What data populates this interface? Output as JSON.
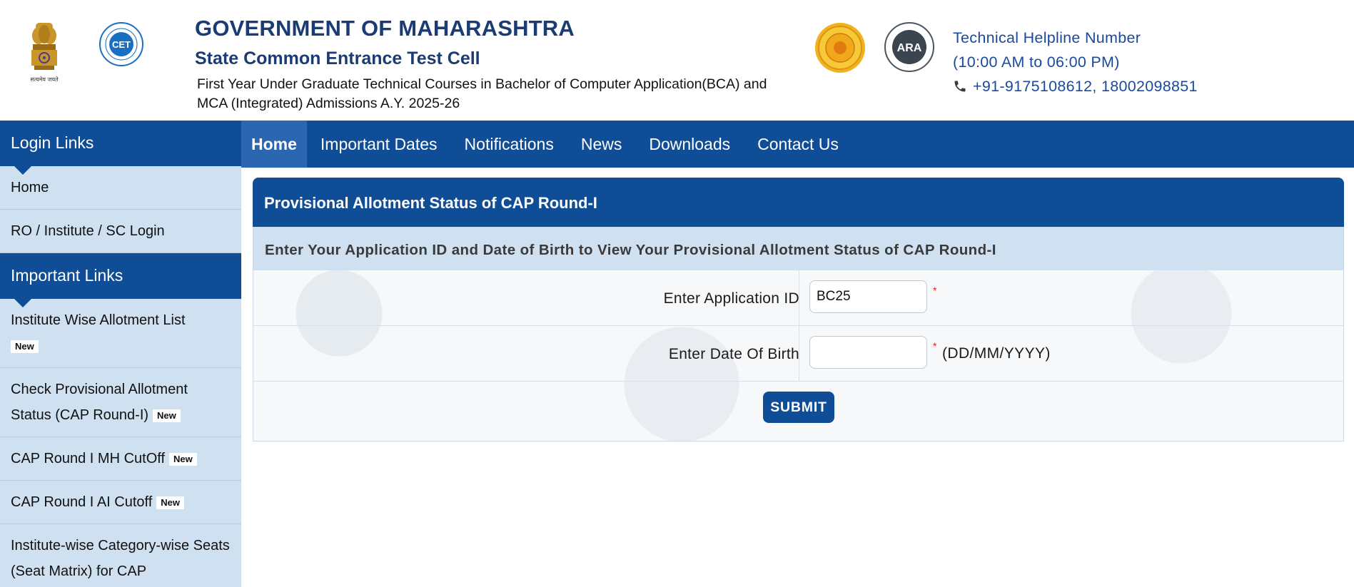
{
  "header": {
    "title": "GOVERNMENT OF MAHARASHTRA",
    "subtitle": "State Common Entrance Test Cell",
    "description": "First Year Under Graduate Technical Courses in Bachelor of Computer Application(BCA) and MCA (Integrated) Admissions A.Y. 2025-26",
    "emblem_caption": "सत्यमेव जयते",
    "cet_logo_text": "CET",
    "ara_logo_text": "ARA",
    "helpline": {
      "label": "Technical Helpline Number",
      "hours": "(10:00 AM to 06:00 PM)",
      "numbers": "+91-9175108612, 18002098851"
    }
  },
  "nav": {
    "items": [
      {
        "label": "Home",
        "active": true
      },
      {
        "label": "Important Dates"
      },
      {
        "label": "Notifications"
      },
      {
        "label": "News"
      },
      {
        "label": "Downloads"
      },
      {
        "label": "Contact Us"
      }
    ]
  },
  "sidebar": {
    "login_heading": "Login Links",
    "login_items": [
      {
        "label": "Home"
      },
      {
        "label": "RO / Institute / SC Login"
      }
    ],
    "important_heading": "Important Links",
    "important_items": [
      {
        "label": "Institute Wise Allotment List",
        "badge": "New"
      },
      {
        "label": "Check Provisional Allotment Status (CAP Round-I)",
        "badge": "New"
      },
      {
        "label": "CAP Round I MH CutOff",
        "badge": "New"
      },
      {
        "label": "CAP Round I AI Cutoff",
        "badge": "New"
      },
      {
        "label": "Institute-wise Category-wise Seats (Seat Matrix) for CAP"
      }
    ]
  },
  "panel": {
    "title": "Provisional Allotment Status of CAP Round-I",
    "instruction": "Enter Your Application ID and Date of Birth to View Your Provisional Allotment Status of CAP Round-I",
    "app_id_label": "Enter Application ID",
    "app_id_value": "BC25",
    "dob_label": "Enter Date Of Birth",
    "dob_value": "",
    "dob_format": "(DD/MM/YYYY)",
    "required_mark": "*",
    "submit_label": "SUBMIT"
  },
  "colors": {
    "primary_blue": "#0f4d96",
    "active_nav": "#2b67b0",
    "sidebar_bg": "#cfe0f1",
    "title_blue": "#1a3b73",
    "helpline_blue": "#1a4a9c",
    "required_red": "#e02020"
  }
}
